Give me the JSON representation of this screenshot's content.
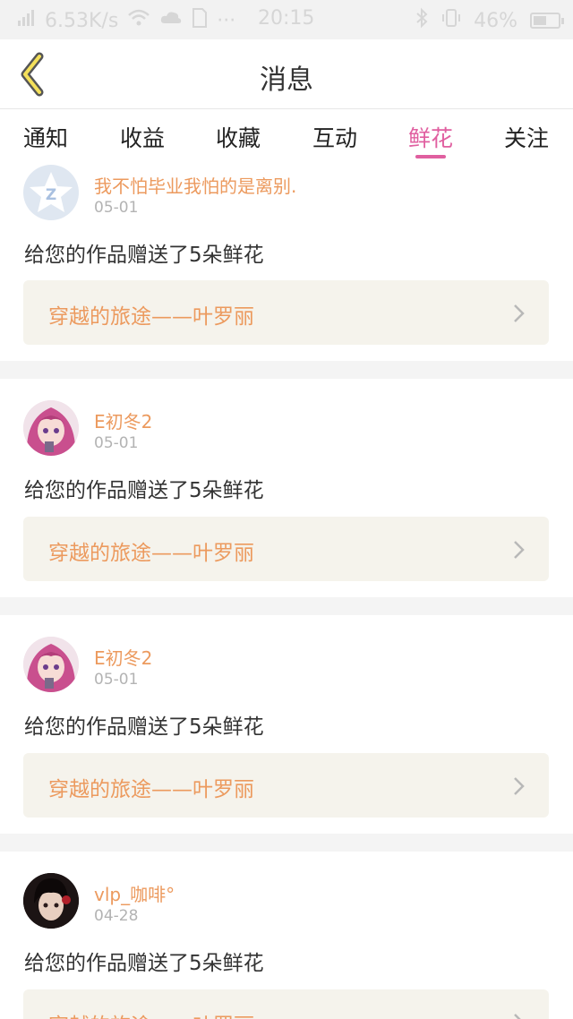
{
  "status_bar": {
    "speed": "6.53K/s",
    "time": "20:15",
    "battery": "46%",
    "icons": [
      "signal-icon",
      "wifi-icon",
      "cloud-icon",
      "sim-icon",
      "bluetooth-icon",
      "vibrate-icon",
      "battery-icon"
    ]
  },
  "header": {
    "title": "消息",
    "back_icon": "chevron-left-icon"
  },
  "tabs": [
    {
      "label": "通知",
      "active": false
    },
    {
      "label": "收益",
      "active": false
    },
    {
      "label": "收藏",
      "active": false
    },
    {
      "label": "互动",
      "active": false
    },
    {
      "label": "鲜花",
      "active": true
    },
    {
      "label": "关注",
      "active": false
    }
  ],
  "colors": {
    "accent_pink": "#e05fa0",
    "username_orange": "#ec9a5e",
    "link_bg": "#f5f3ec"
  },
  "items": [
    {
      "username": "我不怕毕业我怕的是离别.",
      "date": "05-01",
      "message": "给您的作品赠送了5朵鲜花",
      "work": "穿越的旅途——叶罗丽",
      "avatar": "default-star-avatar"
    },
    {
      "username": "E初冬2",
      "date": "05-01",
      "message": "给您的作品赠送了5朵鲜花",
      "work": "穿越的旅途——叶罗丽",
      "avatar": "anime-girl-pink-avatar"
    },
    {
      "username": "E初冬2",
      "date": "05-01",
      "message": "给您的作品赠送了5朵鲜花",
      "work": "穿越的旅途——叶罗丽",
      "avatar": "anime-girl-pink-avatar"
    },
    {
      "username": "vlp_咖啡°",
      "date": "04-28",
      "message": "给您的作品赠送了5朵鲜花",
      "work": "穿越的旅途——叶罗丽",
      "avatar": "dark-hair-girl-avatar"
    }
  ]
}
